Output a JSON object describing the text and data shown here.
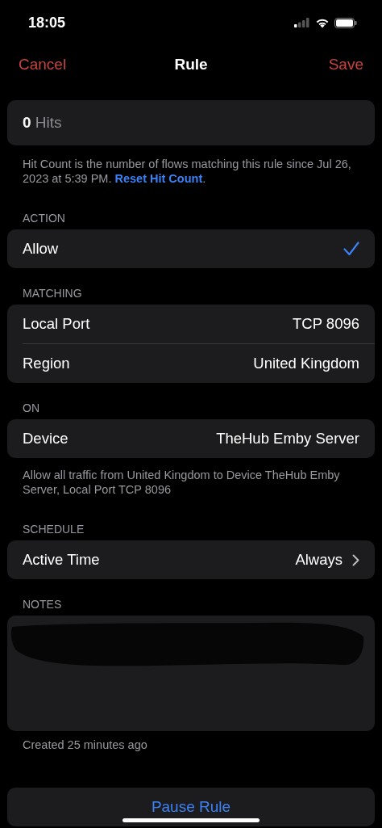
{
  "status_bar": {
    "time": "18:05"
  },
  "nav": {
    "cancel": "Cancel",
    "title": "Rule",
    "save": "Save"
  },
  "hits": {
    "count": "0",
    "label": "Hits"
  },
  "hits_note": {
    "text": "Hit Count is the number of flows matching this rule since Jul 26, 2023 at 5:39 PM.",
    "link": "Reset Hit Count",
    "end": "."
  },
  "sections": [
    {
      "header": "ACTION",
      "rows": [
        {
          "kind": "choice",
          "label": "Allow",
          "selected": true
        }
      ]
    },
    {
      "header": "MATCHING",
      "rows": [
        {
          "kind": "value",
          "label": "Local Port",
          "value": "TCP 8096"
        },
        {
          "kind": "value",
          "label": "Region",
          "value": "United Kingdom"
        }
      ]
    },
    {
      "header": "ON",
      "rows": [
        {
          "kind": "value",
          "label": "Device",
          "value": "TheHub Emby Server"
        }
      ],
      "footer": "Allow all traffic from United Kingdom to Device TheHub Emby Server, Local Port TCP 8096"
    },
    {
      "header": "SCHEDULE",
      "rows": [
        {
          "kind": "link",
          "label": "Active Time",
          "value": "Always"
        }
      ]
    }
  ],
  "notes": {
    "header": "NOTES"
  },
  "created": "Created 25 minutes ago",
  "pause_button": "Pause Rule"
}
